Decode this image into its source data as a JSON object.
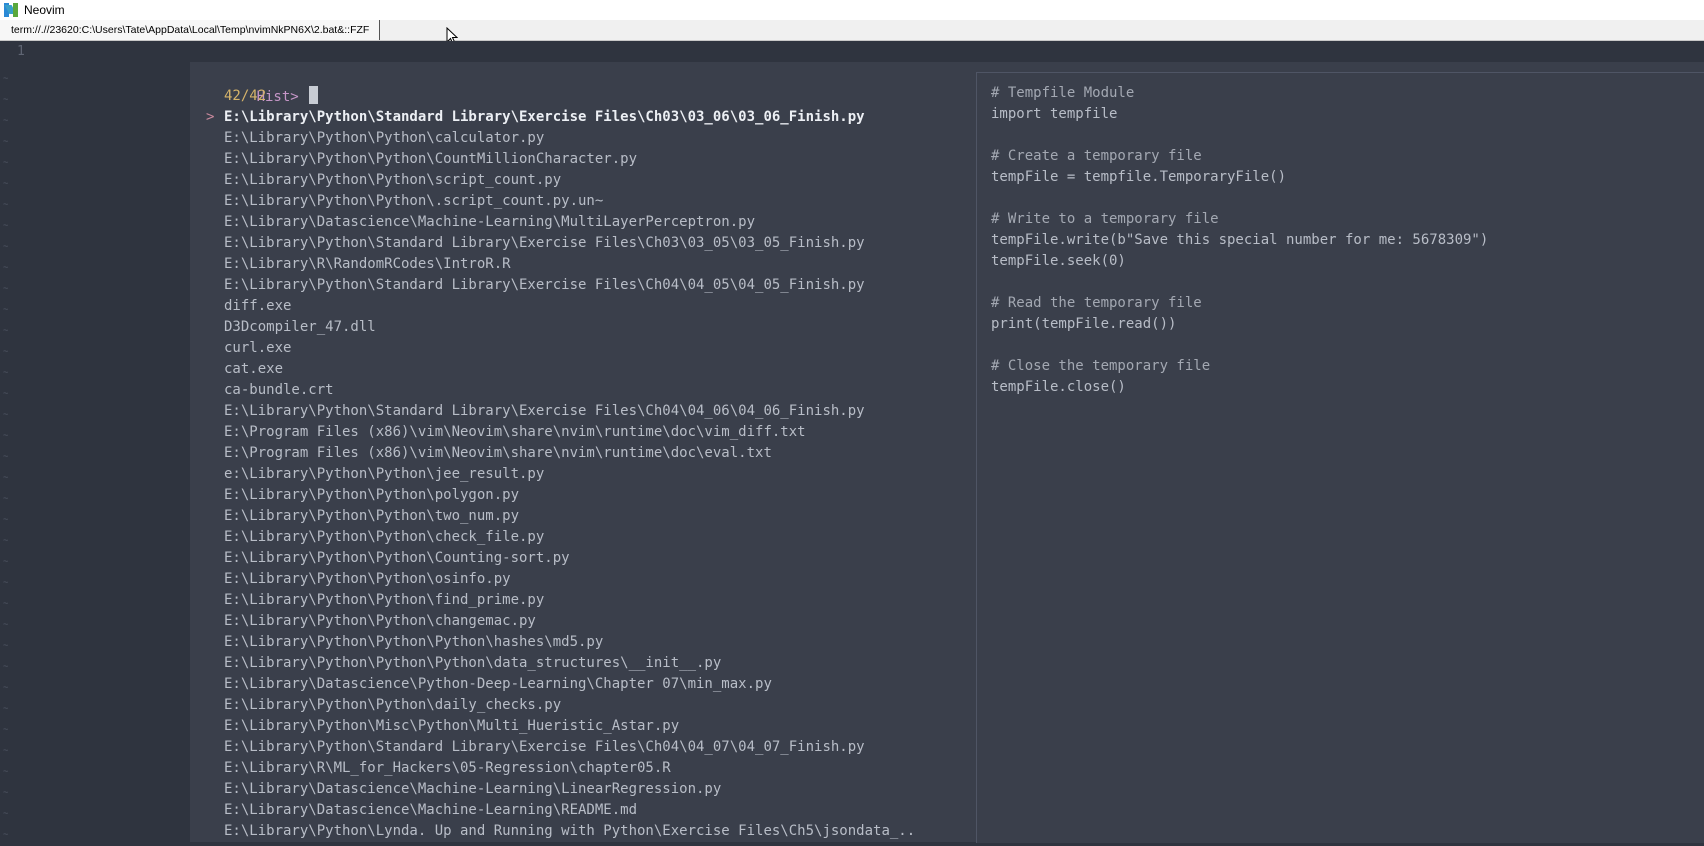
{
  "window": {
    "title": "Neovim"
  },
  "tab": {
    "label": "term://.//23620:C:\\Users\\Tate\\AppData\\Local\\Temp\\nvimNkPN6X\\2.bat&::FZF"
  },
  "editor": {
    "line_number": "1",
    "tilde": "~"
  },
  "fzf": {
    "prompt": "Hist>",
    "count": "42/42",
    "pointer": ">",
    "results": [
      "E:\\Library\\Python\\Standard Library\\Exercise Files\\Ch03\\03_06\\03_06_Finish.py",
      "E:\\Library\\Python\\Python\\calculator.py",
      "E:\\Library\\Python\\Python\\CountMillionCharacter.py",
      "E:\\Library\\Python\\Python\\script_count.py",
      "E:\\Library\\Python\\Python\\.script_count.py.un~",
      "E:\\Library\\Datascience\\Machine-Learning\\MultiLayerPerceptron.py",
      "E:\\Library\\Python\\Standard Library\\Exercise Files\\Ch03\\03_05\\03_05_Finish.py",
      "E:\\Library\\R\\RandomRCodes\\IntroR.R",
      "E:\\Library\\Python\\Standard Library\\Exercise Files\\Ch04\\04_05\\04_05_Finish.py",
      "diff.exe",
      "D3Dcompiler_47.dll",
      "curl.exe",
      "cat.exe",
      "ca-bundle.crt",
      "E:\\Library\\Python\\Standard Library\\Exercise Files\\Ch04\\04_06\\04_06_Finish.py",
      "E:\\Program Files (x86)\\vim\\Neovim\\share\\nvim\\runtime\\doc\\vim_diff.txt",
      "E:\\Program Files (x86)\\vim\\Neovim\\share\\nvim\\runtime\\doc\\eval.txt",
      "e:\\Library\\Python\\Python\\jee_result.py",
      "E:\\Library\\Python\\Python\\polygon.py",
      "E:\\Library\\Python\\Python\\two_num.py",
      "E:\\Library\\Python\\Python\\check_file.py",
      "E:\\Library\\Python\\Python\\Counting-sort.py",
      "E:\\Library\\Python\\Python\\osinfo.py",
      "E:\\Library\\Python\\Python\\find_prime.py",
      "E:\\Library\\Python\\Python\\changemac.py",
      "E:\\Library\\Python\\Python\\Python\\hashes\\md5.py",
      "E:\\Library\\Python\\Python\\Python\\data_structures\\__init__.py",
      "E:\\Library\\Datascience\\Python-Deep-Learning\\Chapter 07\\min_max.py",
      "E:\\Library\\Python\\Python\\daily_checks.py",
      "E:\\Library\\Python\\Misc\\Python\\Multi_Hueristic_Astar.py",
      "E:\\Library\\Python\\Standard Library\\Exercise Files\\Ch04\\04_07\\04_07_Finish.py",
      "E:\\Library\\R\\ML_for_Hackers\\05-Regression\\chapter05.R",
      "E:\\Library\\Datascience\\Machine-Learning\\LinearRegression.py",
      "E:\\Library\\Datascience\\Machine-Learning\\README.md",
      "E:\\Library\\Python\\Lynda. Up and Running with Python\\Exercise Files\\Ch5\\jsondata_.."
    ]
  },
  "preview": {
    "lines": [
      "# Tempfile Module",
      "import tempfile",
      "",
      "# Create a temporary file",
      "tempFile = tempfile.TemporaryFile()",
      "",
      "# Write to a temporary file",
      "tempFile.write(b\"Save this special number for me: 5678309\")",
      "tempFile.seek(0)",
      "",
      "# Read the temporary file",
      "print(tempFile.read())",
      "",
      "# Close the temporary file",
      "tempFile.close()"
    ]
  }
}
